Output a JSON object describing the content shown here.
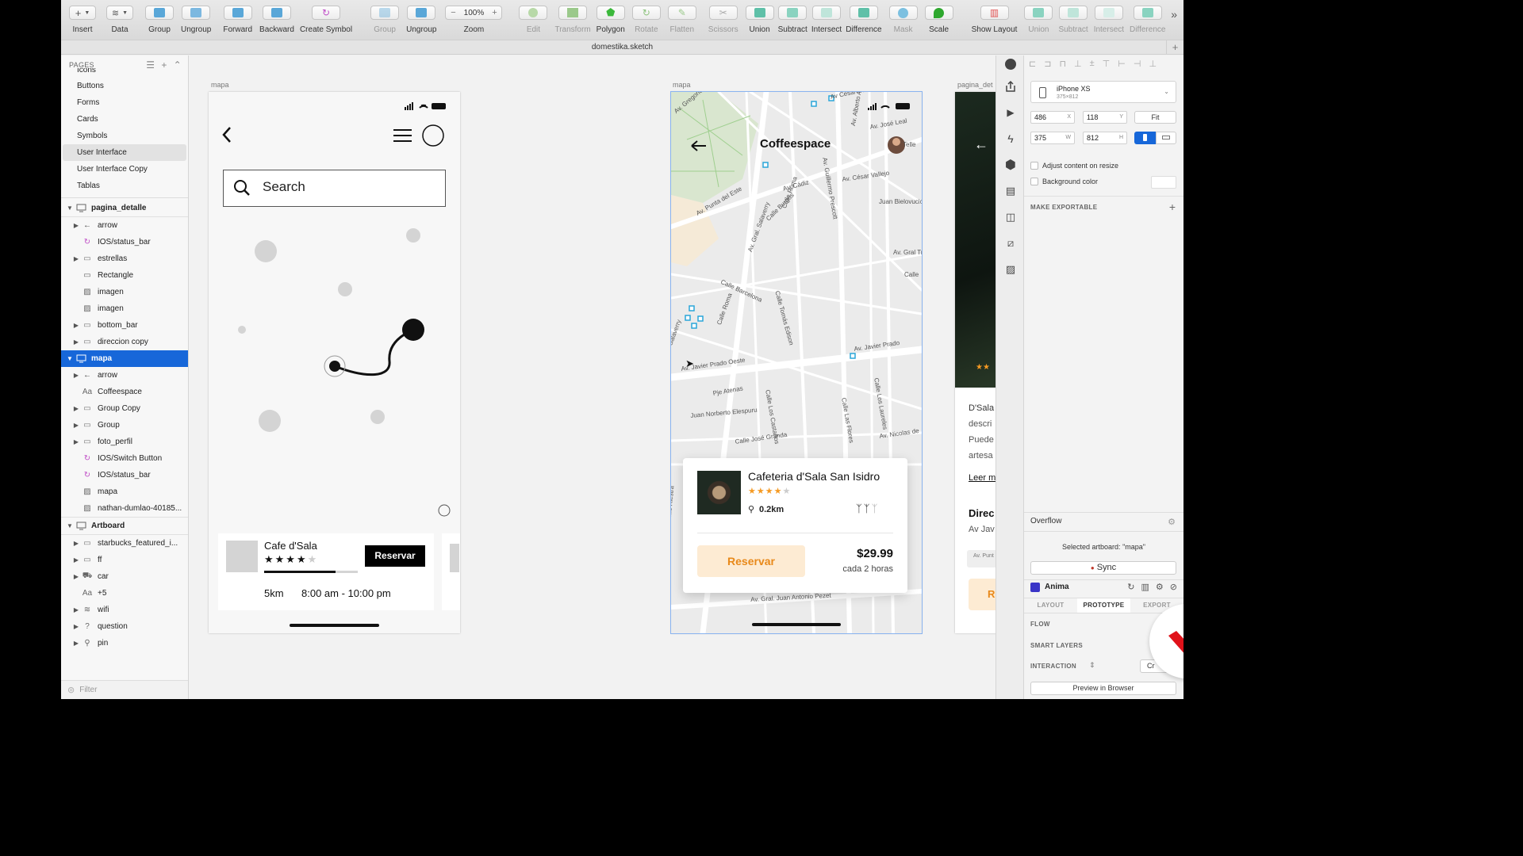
{
  "toolbar": {
    "items": [
      {
        "label": "Insert"
      },
      {
        "label": "Data"
      },
      {
        "label": "Group"
      },
      {
        "label": "Ungroup"
      },
      {
        "label": "Forward"
      },
      {
        "label": "Backward"
      },
      {
        "label": "Create Symbol"
      },
      {
        "label": "Group"
      },
      {
        "label": "Ungroup"
      },
      {
        "label": "Zoom",
        "value": "100%"
      },
      {
        "label": "Edit"
      },
      {
        "label": "Transform"
      },
      {
        "label": "Polygon"
      },
      {
        "label": "Rotate"
      },
      {
        "label": "Flatten"
      },
      {
        "label": "Scissors"
      },
      {
        "label": "Union"
      },
      {
        "label": "Subtract"
      },
      {
        "label": "Intersect"
      },
      {
        "label": "Difference"
      },
      {
        "label": "Mask"
      },
      {
        "label": "Scale"
      },
      {
        "label": "Show Layout"
      },
      {
        "label": "Union"
      },
      {
        "label": "Subtract"
      },
      {
        "label": "Intersect"
      },
      {
        "label": "Difference"
      }
    ]
  },
  "document": {
    "title": "domestika.sketch"
  },
  "pages": {
    "header": "PAGES",
    "items": [
      "Icons",
      "Buttons",
      "Forms",
      "Cards",
      "Symbols",
      "User Interface",
      "User Interface Copy",
      "Tablas"
    ],
    "selected": "User Interface"
  },
  "layers": {
    "pagina_detalle": {
      "name": "pagina_detalle",
      "children": [
        "arrow",
        "IOS/status_bar",
        "estrellas",
        "Rectangle",
        "imagen",
        "imagen",
        "bottom_bar",
        "direccion copy"
      ]
    },
    "mapa": {
      "name": "mapa",
      "children": [
        "arrow",
        "Coffeespace",
        "Group Copy",
        "Group",
        "foto_perfil",
        "IOS/Switch Button",
        "IOS/status_bar",
        "mapa",
        "nathan-dumlao-40185..."
      ]
    },
    "artboard": {
      "name": "Artboard",
      "children": [
        "starbucks_featured_i...",
        "ff",
        "car",
        "+5",
        "wifi",
        "question",
        "pin"
      ]
    },
    "filter_placeholder": "Filter"
  },
  "canvas": {
    "wireframe": {
      "label": "mapa",
      "search_placeholder": "Search",
      "card_title": "Cafe d'Sala",
      "card_button": "Reservar",
      "card_distance": "5km",
      "card_hours": "8:00 am - 10:00 pm",
      "rating": 4
    },
    "map_screen": {
      "label": "mapa",
      "title": "Coffeespace",
      "streets": [
        "Av César Canevaro",
        "Av. Gregorio Es",
        "Av. Alberto Alexander",
        "Av. José Leal",
        "Telle",
        "Av. Punta del Este",
        "Av. Cádiz",
        "Av. César Vallejo",
        "Juan Bielovucich",
        "Av. Gral. Salaverry",
        "Calle Burgos",
        "Calle Roma",
        "Av. Guillermo Prescott",
        "Av. Gral Trinid",
        "Calle Tomás Edison",
        "Calle",
        "Calle Barcelona",
        "Calle Roma",
        "Av. Javier Prado",
        "Av. Javier Prado Oeste",
        "Pje Atenas",
        "Calle Los Castaños",
        "Calle Las Flores",
        "Calle Los Laureles",
        "Juan Norberto Elespuru",
        "Calle José Granda",
        "Av. Nicolas de",
        "Av. Gral. Juan Antonio Pezet",
        "Calle F. Valle Riestra",
        "Av. Salaverry"
      ],
      "card_title": "Cafeteria d'Sala San Isidro",
      "distance": "0.2km",
      "button": "Reservar",
      "price": "$29.99",
      "price_note": "cada 2 horas",
      "rating": 4
    },
    "detail_screen": {
      "label": "pagina_det",
      "text_lines": [
        "D'Sala",
        "descri",
        "Puede",
        "artesa"
      ],
      "link": "Leer m",
      "heading": "Direc",
      "address": "Av Jav",
      "map_snippet": "Av. Punt",
      "button": "R"
    }
  },
  "inspector": {
    "device": "iPhone XS",
    "device_size": "375×812",
    "x": "486",
    "x_label": "X",
    "y": "118",
    "y_label": "Y",
    "w": "375",
    "w_label": "W",
    "h": "812",
    "h_label": "H",
    "fit": "Fit",
    "adjust_label": "Adjust content on resize",
    "bg_label": "Background color",
    "exportable": "MAKE EXPORTABLE",
    "overflow": "Overflow",
    "selected_artboard": "Selected artboard: \"mapa\"",
    "sync": "Sync",
    "anima": "Anima",
    "tabs": [
      "LAYOUT",
      "PROTOTYPE",
      "EXPORT"
    ],
    "flow": "FLOW",
    "smart_layers": "SMART LAYERS",
    "interaction": "INTERACTION",
    "interaction_btn": "Cr",
    "preview": "Preview in Browser"
  },
  "colors": {
    "accent": "#1767d9",
    "orange": "#f59a23",
    "brand_red": "#e0121a"
  }
}
